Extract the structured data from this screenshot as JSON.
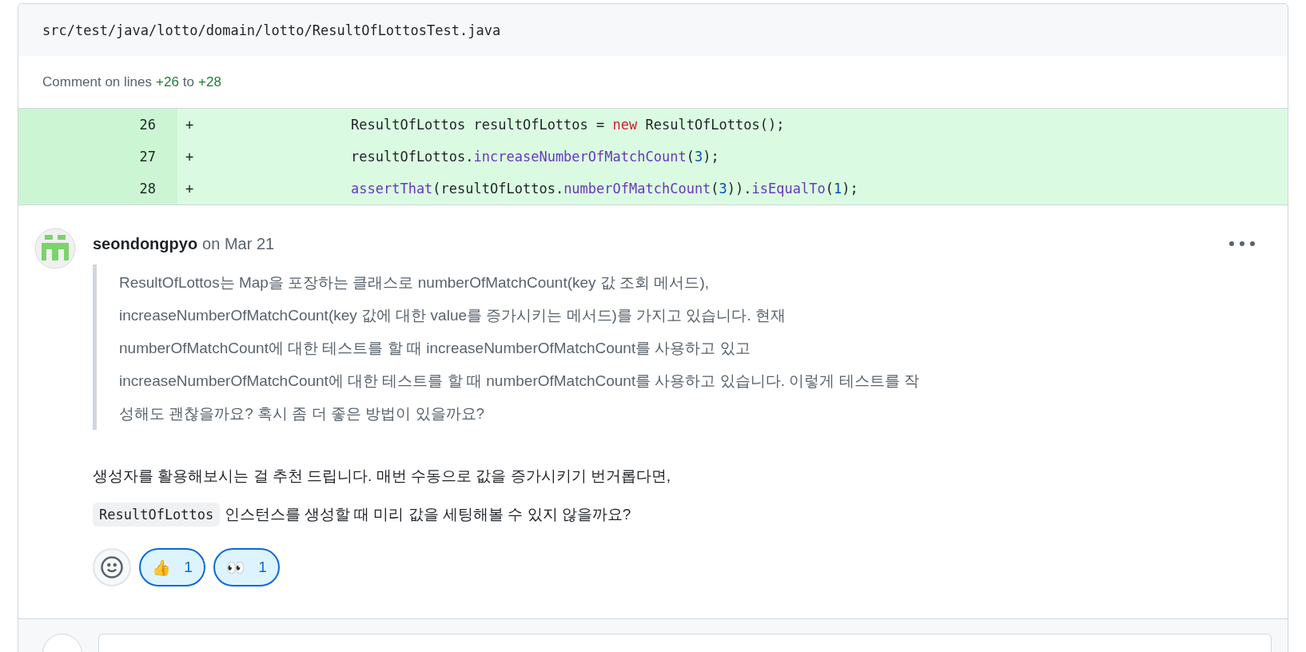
{
  "file_header": {
    "path": "src/test/java/lotto/domain/lotto/ResultOfLottosTest.java"
  },
  "comment_range": {
    "prefix": "Comment on lines",
    "from": "+26",
    "middle": "to",
    "to": "+28"
  },
  "diff_lines": [
    {
      "number": "26",
      "sign": "+",
      "tokens": [
        {
          "text": "ResultOfLottos resultOfLottos = ",
          "kind": "plain"
        },
        {
          "text": "new",
          "kind": "keyword"
        },
        {
          "text": " ResultOfLottos();",
          "kind": "plain"
        }
      ]
    },
    {
      "number": "27",
      "sign": "+",
      "tokens": [
        {
          "text": "resultOfLottos.",
          "kind": "plain"
        },
        {
          "text": "increaseNumberOfMatchCount",
          "kind": "method"
        },
        {
          "text": "(",
          "kind": "plain"
        },
        {
          "text": "3",
          "kind": "number"
        },
        {
          "text": ");",
          "kind": "plain"
        }
      ]
    },
    {
      "number": "28",
      "sign": "+",
      "tokens": [
        {
          "text": "assertThat",
          "kind": "method"
        },
        {
          "text": "(resultOfLottos.",
          "kind": "plain"
        },
        {
          "text": "numberOfMatchCount",
          "kind": "method"
        },
        {
          "text": "(",
          "kind": "plain"
        },
        {
          "text": "3",
          "kind": "number"
        },
        {
          "text": ")).",
          "kind": "plain"
        },
        {
          "text": "isEqualTo",
          "kind": "method"
        },
        {
          "text": "(",
          "kind": "plain"
        },
        {
          "text": "1",
          "kind": "number"
        },
        {
          "text": ");",
          "kind": "plain"
        }
      ]
    }
  ],
  "comment": {
    "author": "seondongpyo",
    "date": "on Mar 21",
    "quote": "ResultOfLottos는 Map을 포장하는 클래스로 numberOfMatchCount(key 값 조회 메서드),\nincreaseNumberOfMatchCount(key 값에 대한 value를 증가시키는 메서드)를 가지고 있습니다. 현재\nnumberOfMatchCount에 대한 테스트를 할 때 increaseNumberOfMatchCount를 사용하고 있고\nincreaseNumberOfMatchCount에 대한 테스트를 할 때 numberOfMatchCount를 사용하고 있습니다. 이렇게 테스트를 작\n성해도 괜찮을까요? 혹시 좀 더 좋은 방법이 있을까요?",
    "reply_line_1": "생성자를 활용해보시는 걸 추천 드립니다. 매번 수동으로 값을 증가시키기 번거롭다면,",
    "reply_code": "ResultOfLottos",
    "reply_line_2": "인스턴스를 생성할 때 미리 값을 세팅해볼 수 있지 않을까요?",
    "reactions": [
      {
        "emoji": "👍",
        "count": "1",
        "selected": true
      },
      {
        "emoji": "👀",
        "count": "1",
        "selected": true
      }
    ]
  }
}
